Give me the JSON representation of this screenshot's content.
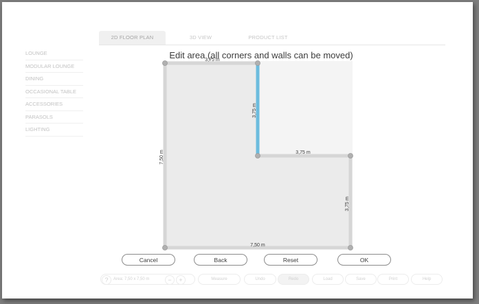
{
  "tabs": [
    {
      "label": "2D FLOOR PLAN",
      "active": true
    },
    {
      "label": "3D VIEW",
      "active": false
    },
    {
      "label": "PRODUCT LIST",
      "active": false
    }
  ],
  "sidebar": {
    "items": [
      "LOUNGE",
      "MODULAR LOUNGE",
      "DINING",
      "OCCASIONAL TABLE",
      "ACCESSORIES",
      "PARASOLS",
      "LIGHTING"
    ]
  },
  "editor": {
    "title": "Edit area (all corners and walls can be moved)",
    "dimensions": {
      "top": "3,75 m",
      "inner_vertical": "3,75 m",
      "inner_horizontal": "3,75 m",
      "left": "7,50 m",
      "right": "3,75 m",
      "bottom": "7,50 m"
    },
    "colors": {
      "selected_wall": "#6cbcde",
      "wall": "#d6d6d6",
      "floor": "#ebebeb",
      "corner": "#a8a8a8"
    }
  },
  "dialog_buttons": {
    "cancel": "Cancel",
    "back": "Back",
    "reset": "Reset",
    "ok": "OK"
  },
  "toolbar": {
    "info_icon": "?",
    "area": "Area: 7,50 x 7,50 m",
    "zoom_out": "−",
    "zoom_in": "+",
    "measure": "Measure",
    "undo": "Undo",
    "redo": "Redo",
    "load": "Load",
    "save": "Save",
    "print": "Print",
    "help": "Help"
  }
}
